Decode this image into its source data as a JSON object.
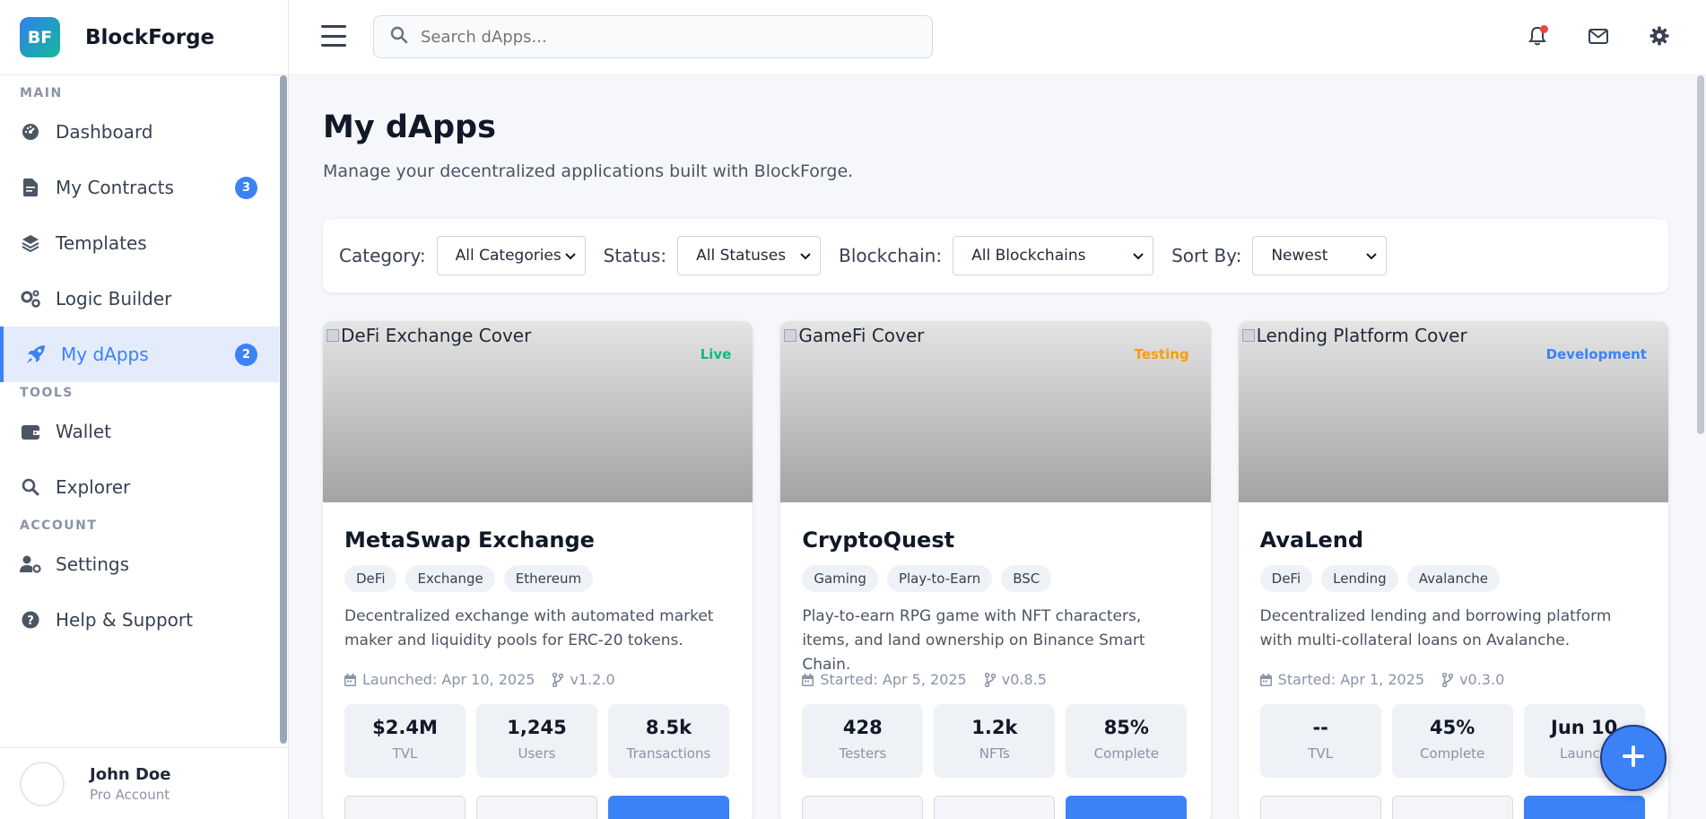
{
  "brand": {
    "logo_text": "BF",
    "name": "BlockForge"
  },
  "sidebar": {
    "sections": [
      {
        "label": "MAIN",
        "items": [
          {
            "label": "Dashboard",
            "icon": "dashboard-icon"
          },
          {
            "label": "My Contracts",
            "icon": "contract-icon",
            "badge": "3"
          },
          {
            "label": "Templates",
            "icon": "layers-icon"
          },
          {
            "label": "Logic Builder",
            "icon": "gears-icon"
          },
          {
            "label": "My dApps",
            "icon": "rocket-icon",
            "badge": "2",
            "active": true
          }
        ]
      },
      {
        "label": "TOOLS",
        "items": [
          {
            "label": "Wallet",
            "icon": "wallet-icon"
          },
          {
            "label": "Explorer",
            "icon": "search-icon"
          }
        ]
      },
      {
        "label": "ACCOUNT",
        "items": [
          {
            "label": "Settings",
            "icon": "user-gear-icon"
          },
          {
            "label": "Help & Support",
            "icon": "help-icon"
          }
        ]
      }
    ],
    "user": {
      "name": "John Doe",
      "role": "Pro Account"
    }
  },
  "topbar": {
    "search_placeholder": "Search dApps...",
    "notification_dot_color": "#ef4444"
  },
  "page": {
    "title": "My dApps",
    "subtitle": "Manage your decentralized applications built with BlockForge."
  },
  "filters": {
    "category": {
      "label": "Category:",
      "value": "All Categories"
    },
    "status": {
      "label": "Status:",
      "value": "All Statuses"
    },
    "blockchain": {
      "label": "Blockchain:",
      "value": "All Blockchains"
    },
    "sort": {
      "label": "Sort By:",
      "value": "Newest"
    }
  },
  "cards": [
    {
      "cover_alt": "DeFi Exchange Cover",
      "status": "Live",
      "status_color": "#10b981",
      "title": "MetaSwap Exchange",
      "tags": [
        "DeFi",
        "Exchange",
        "Ethereum"
      ],
      "description": "Decentralized exchange with automated market maker and liquidity pools for ERC-20 tokens.",
      "date": "Launched: Apr 10, 2025",
      "version": "v1.2.0",
      "stats": [
        {
          "value": "$2.4M",
          "label": "TVL"
        },
        {
          "value": "1,245",
          "label": "Users"
        },
        {
          "value": "8.5k",
          "label": "Transactions"
        }
      ]
    },
    {
      "cover_alt": "GameFi Cover",
      "status": "Testing",
      "status_color": "#f59e0b",
      "title": "CryptoQuest",
      "tags": [
        "Gaming",
        "Play-to-Earn",
        "BSC"
      ],
      "description": "Play-to-earn RPG game with NFT characters, items, and land ownership on Binance Smart Chain.",
      "date": "Started: Apr 5, 2025",
      "version": "v0.8.5",
      "stats": [
        {
          "value": "428",
          "label": "Testers"
        },
        {
          "value": "1.2k",
          "label": "NFTs"
        },
        {
          "value": "85%",
          "label": "Complete"
        }
      ]
    },
    {
      "cover_alt": "Lending Platform Cover",
      "status": "Development",
      "status_color": "#3b82f6",
      "title": "AvaLend",
      "tags": [
        "DeFi",
        "Lending",
        "Avalanche"
      ],
      "description": "Decentralized lending and borrowing platform with multi-collateral loans on Avalanche.",
      "date": "Started: Apr 1, 2025",
      "version": "v0.3.0",
      "stats": [
        {
          "value": "--",
          "label": "TVL"
        },
        {
          "value": "45%",
          "label": "Complete"
        },
        {
          "value": "Jun 10",
          "label": "Launch"
        }
      ]
    }
  ],
  "accent_color": "#3b82f6"
}
